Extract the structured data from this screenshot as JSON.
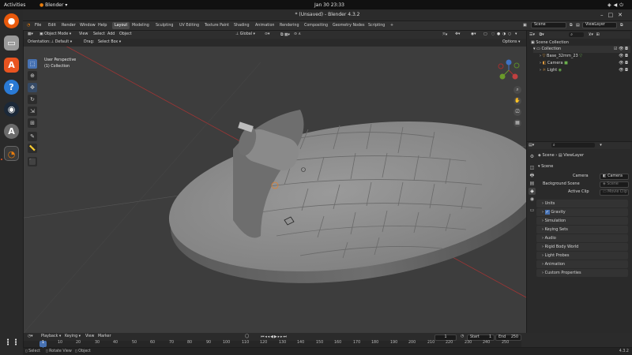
{
  "os": {
    "activities": "Activities",
    "app_name": "Blender",
    "clock": "Jan 30  23:33"
  },
  "window": {
    "title": "* (Unsaved) - Blender 4.3.2"
  },
  "menu": {
    "items": [
      "File",
      "Edit",
      "Render",
      "Window",
      "Help"
    ]
  },
  "workspaces": {
    "tabs": [
      "Layout",
      "Modeling",
      "Sculpting",
      "UV Editing",
      "Texture Paint",
      "Shading",
      "Animation",
      "Rendering",
      "Compositing",
      "Geometry Nodes",
      "Scripting"
    ],
    "active": "Layout",
    "add": "+"
  },
  "topright": {
    "scene": "Scene",
    "view_layer": "ViewLayer"
  },
  "viewport": {
    "mode": "Object Mode",
    "view": "View",
    "select": "Select",
    "add": "Add",
    "object": "Object",
    "orientation_label": "Orientation:",
    "orientation": "Default",
    "drag_label": "Drag:",
    "drag": "Select Box",
    "transform": "Global",
    "options": "Options",
    "overlay_line1": "User Perspective",
    "overlay_line2": "(1) Collection",
    "gizmo": {
      "x": "X",
      "y": "Y",
      "z": "Z"
    }
  },
  "outliner": {
    "root": "Scene Collection",
    "collection": "Collection",
    "items": [
      {
        "name": "Base_32mm_23"
      },
      {
        "name": "Camera"
      },
      {
        "name": "Light"
      }
    ]
  },
  "properties": {
    "breadcrumb_scene": "Scene",
    "breadcrumb_layer": "ViewLayer",
    "section": "Scene",
    "fields": [
      {
        "label": "Camera",
        "value": "Camera"
      },
      {
        "label": "Background Scene",
        "value": "Scene"
      },
      {
        "label": "Active Clip",
        "value": "Movie Clip"
      }
    ],
    "panels": [
      "Units",
      "Gravity",
      "Simulation",
      "Keying Sets",
      "Audio",
      "Rigid Body World",
      "Light Probes",
      "Animation",
      "Custom Properties"
    ],
    "gravity_checked": true
  },
  "timeline": {
    "playback": "Playback",
    "keying": "Keying",
    "view": "View",
    "marker": "Marker",
    "current_frame": "1",
    "start_label": "Start",
    "start": "1",
    "end_label": "End",
    "end": "250",
    "ticks": [
      "1",
      "10",
      "20",
      "30",
      "40",
      "50",
      "60",
      "70",
      "80",
      "90",
      "100",
      "110",
      "120",
      "130",
      "140",
      "150",
      "160",
      "170",
      "180",
      "190",
      "200",
      "210",
      "220",
      "230",
      "240",
      "250"
    ]
  },
  "status": {
    "select": "Select",
    "rotate": "Rotate View",
    "object": "Object",
    "version": "4.3.2"
  },
  "colors": {
    "accent": "#4772b3",
    "ubuntu_orange": "#e95420",
    "axis_red": "#b03030",
    "axis_green": "#6a9a2a",
    "grid_line": "#5a5a5a"
  }
}
